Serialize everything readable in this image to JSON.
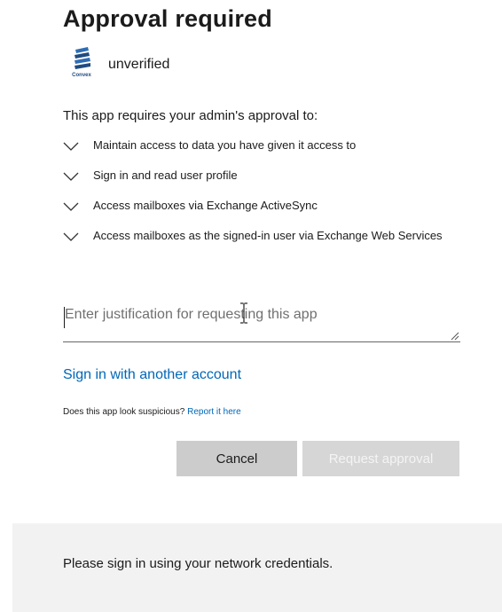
{
  "dialog": {
    "title": "Approval required",
    "app_name": "unverified",
    "logo_text": "Convex",
    "intro": "This app requires your admin's approval to:",
    "permissions": [
      {
        "label": "Maintain access to data you have given it access to"
      },
      {
        "label": "Sign in and read user profile"
      },
      {
        "label": "Access mailboxes via Exchange ActiveSync"
      },
      {
        "label": "Access mailboxes as the signed-in user via Exchange Web Services"
      }
    ],
    "justification_placeholder": "Enter justification for requesting this app",
    "justification_value": "",
    "alt_account_link": "Sign in with another account",
    "suspicious_text": "Does this app look suspicious?",
    "report_link": "Report it here",
    "cancel_label": "Cancel",
    "request_label": "Request approval"
  },
  "footer": {
    "text": "Please sign in using your network credentials."
  },
  "icons": {
    "logo": "convex-logo-icon",
    "permission_expand": "chevron-down-icon",
    "cursor": "text-cursor-icon",
    "resize": "resize-grip-icon"
  },
  "colors": {
    "link": "#0067b8",
    "button_gray": "#cccccc",
    "footer_bg": "#f2f2f2",
    "logo_blue": "#1f4b82"
  }
}
